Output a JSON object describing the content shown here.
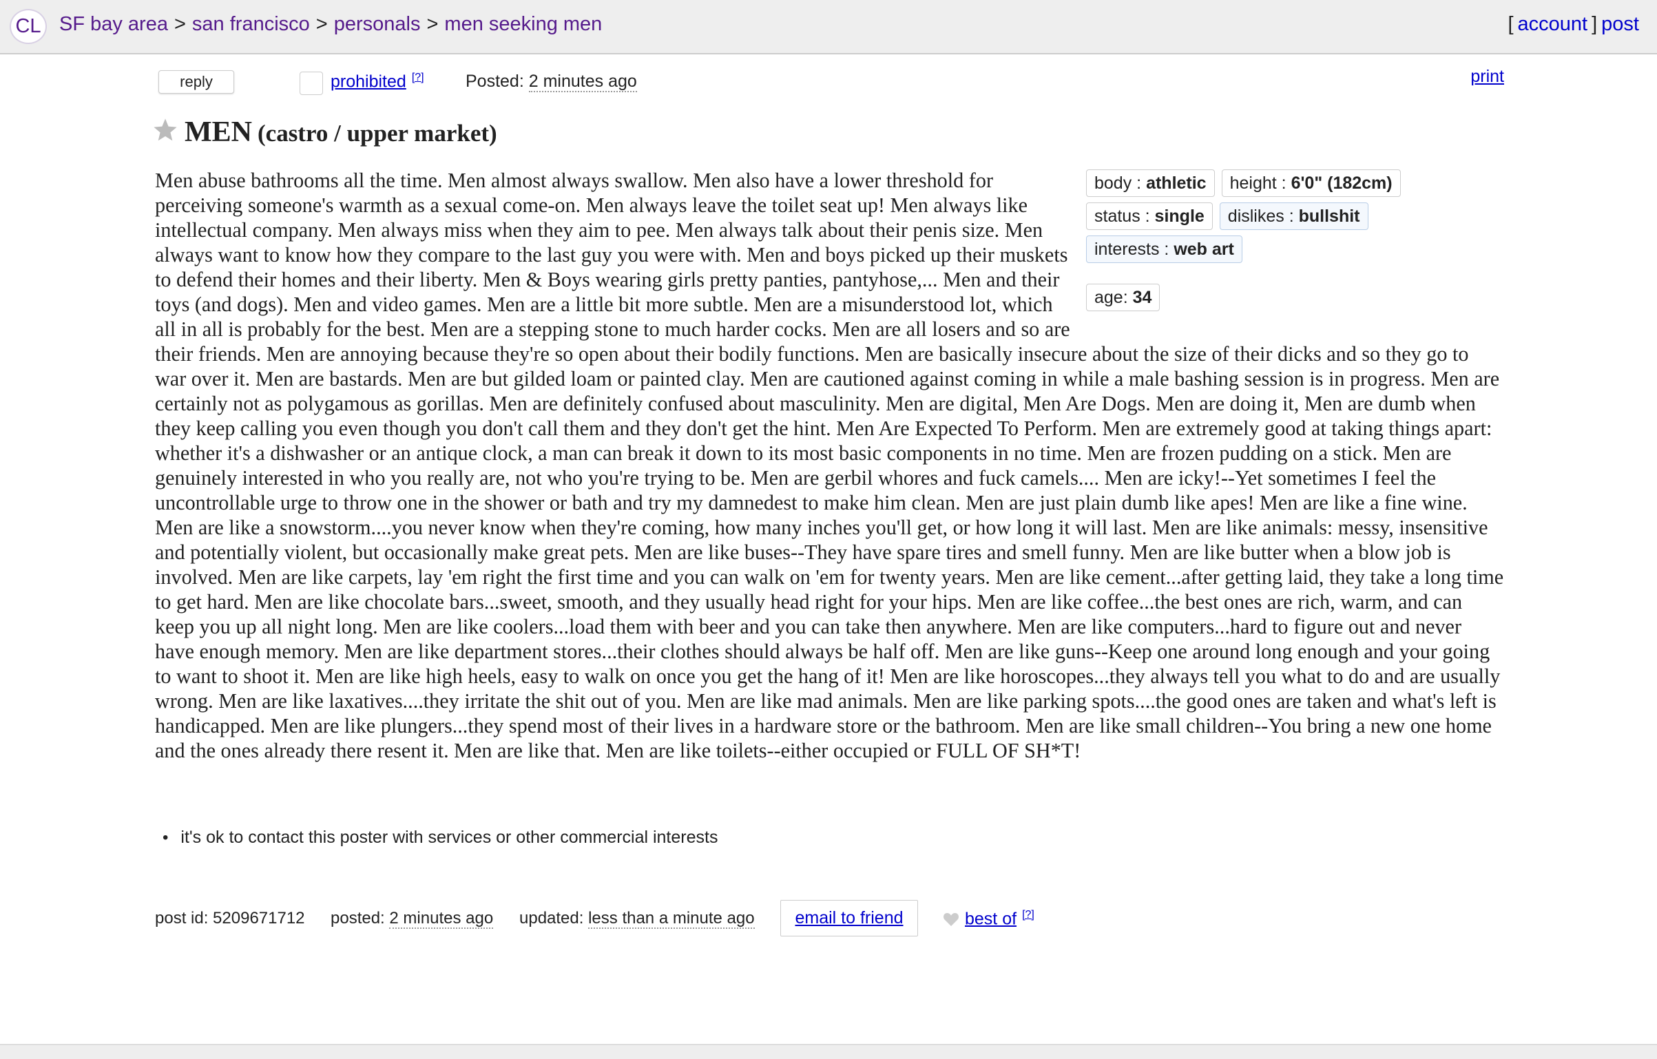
{
  "header": {
    "logo": "CL",
    "breadcrumbs": [
      "SF bay area",
      "san francisco",
      "personals",
      "men seeking men"
    ],
    "separator": ">",
    "bracket_open": "[",
    "account": "account",
    "bracket_close": "]",
    "post": "post"
  },
  "actions": {
    "reply": "reply",
    "prohibited": "prohibited",
    "help": "[?]",
    "posted_label": "Posted:",
    "posted_value": "2 minutes ago",
    "print": "print"
  },
  "posting": {
    "title": "MEN",
    "location": "(castro / upper market)",
    "body": "Men abuse bathrooms all the time. Men almost always swallow. Men also have a lower threshold for perceiving someone's warmth as a sexual come-on. Men always leave the toilet seat up! Men always like intellectual company. Men always miss when they aim to pee. Men always talk about their penis size. Men always want to know how they compare to the last guy you were with. Men and boys picked up their muskets to defend their homes and their liberty. Men & Boys wearing girls pretty panties, pantyhose,... Men and their toys (and dogs). Men and video games. Men are a little bit more subtle. Men are a misunderstood lot, which all in all is probably for the best. Men are a stepping stone to much harder cocks. Men are all losers and so are their friends. Men are annoying because they're so open about their bodily functions. Men are basically insecure about the size of their dicks and so they go to war over it. Men are bastards. Men are but gilded loam or painted clay. Men are cautioned against coming in while a male bashing session is in progress. Men are certainly not as polygamous as gorillas. Men are definitely confused about masculinity. Men are digital, Men Are Dogs. Men are doing it, Men are dumb when they keep calling you even though you don't call them and they don't get the hint. Men Are Expected To Perform. Men are extremely good at taking things apart: whether it's a dishwasher or an antique clock, a man can break it down to its most basic components in no time. Men are frozen pudding on a stick. Men are genuinely interested in who you really are, not who you're trying to be. Men are gerbil whores and fuck camels.... Men are icky!--Yet sometimes I feel the uncontrollable urge to throw one in the shower or bath and try my damnedest to make him clean. Men are just plain dumb like apes! Men are like a fine wine. Men are like a snowstorm....you never know when they're coming, how many inches you'll get, or how long it will last. Men are like animals: messy, insensitive and potentially violent, but occasionally make great pets. Men are like buses--They have spare tires and smell funny. Men are like butter when a blow job is involved. Men are like carpets, lay 'em right the first time and you can walk on 'em for twenty years. Men are like cement...after getting laid, they take a long time to get hard. Men are like chocolate bars...sweet, smooth, and they usually head right for your hips. Men are like coffee...the best ones are rich, warm, and can keep you up all night long. Men are like coolers...load them with beer and you can take then anywhere. Men are like computers...hard to figure out and never have enough memory. Men are like department stores...their clothes should always be half off. Men are like guns--Keep one around long enough and your going to want to shoot it. Men are like high heels, easy to walk on once you get the hang of it! Men are like horoscopes...they always tell you what to do and are usually wrong. Men are like laxatives....they irritate the shit out of you. Men are like mad animals. Men are like parking spots....the good ones are taken and what's left is handicapped. Men are like plungers...they spend most of their lives in a hardware store or the bathroom. Men are like small children--You bring a new one home and the ones already there resent it. Men are like that. Men are like toilets--either occupied or FULL OF SH*T!"
  },
  "attributes": {
    "body": {
      "label": "body :",
      "value": "athletic"
    },
    "height": {
      "label": "height :",
      "value": "6'0\" (182cm)"
    },
    "status": {
      "label": "status :",
      "value": "single"
    },
    "dislikes": {
      "label": "dislikes :",
      "value": "bullshit"
    },
    "interests": {
      "label": "interests :",
      "value": "web art"
    },
    "age": {
      "label": "age:",
      "value": "34"
    }
  },
  "notices": [
    "it's ok to contact this poster with services or other commercial interests"
  ],
  "postinfo": {
    "post_id": "post id: 5209671712",
    "posted_label": "posted:",
    "posted_value": "2 minutes ago",
    "updated_label": "updated:",
    "updated_value": "less than a minute ago",
    "email_to_friend": "email to friend",
    "best_of": "best of",
    "help": "[?]"
  },
  "colors": {
    "topbar": "#eeeeee",
    "breadcrumb_link": "#551a8b",
    "link": "#0000cc",
    "attr_blue_bg": "#f4f8fd"
  }
}
